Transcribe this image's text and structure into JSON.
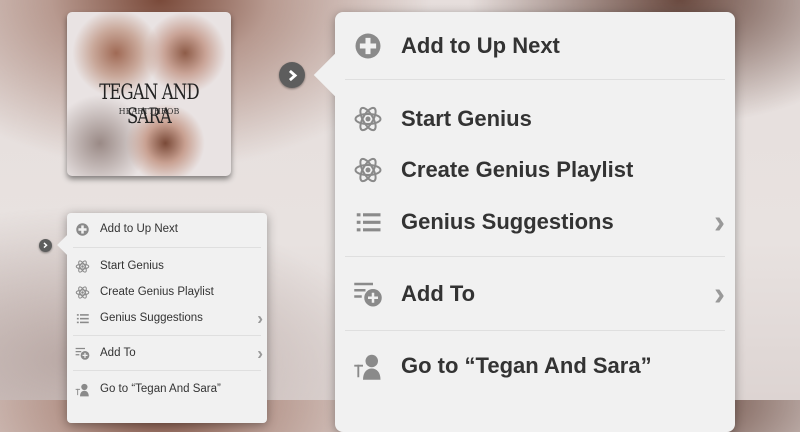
{
  "album": {
    "artist": "TEGAN AND SARA",
    "title": "HEARTTHROB"
  },
  "menu": {
    "items": [
      {
        "label": "Add to Up Next",
        "icon": "plus-circle-icon",
        "submenu": false
      },
      {
        "label": "Start Genius",
        "icon": "atom-icon",
        "submenu": false
      },
      {
        "label": "Create Genius Playlist",
        "icon": "atom-icon",
        "submenu": false
      },
      {
        "label": "Genius Suggestions",
        "icon": "list-icon",
        "submenu": true
      },
      {
        "label": "Add To",
        "icon": "playlist-add-icon",
        "submenu": true
      },
      {
        "label": "Go to “Tegan And Sara”",
        "icon": "artist-icon",
        "submenu": false
      }
    ]
  },
  "colors": {
    "menu_bg": "#f1f1f1",
    "text": "#333333",
    "icon": "#8a8a8a"
  }
}
